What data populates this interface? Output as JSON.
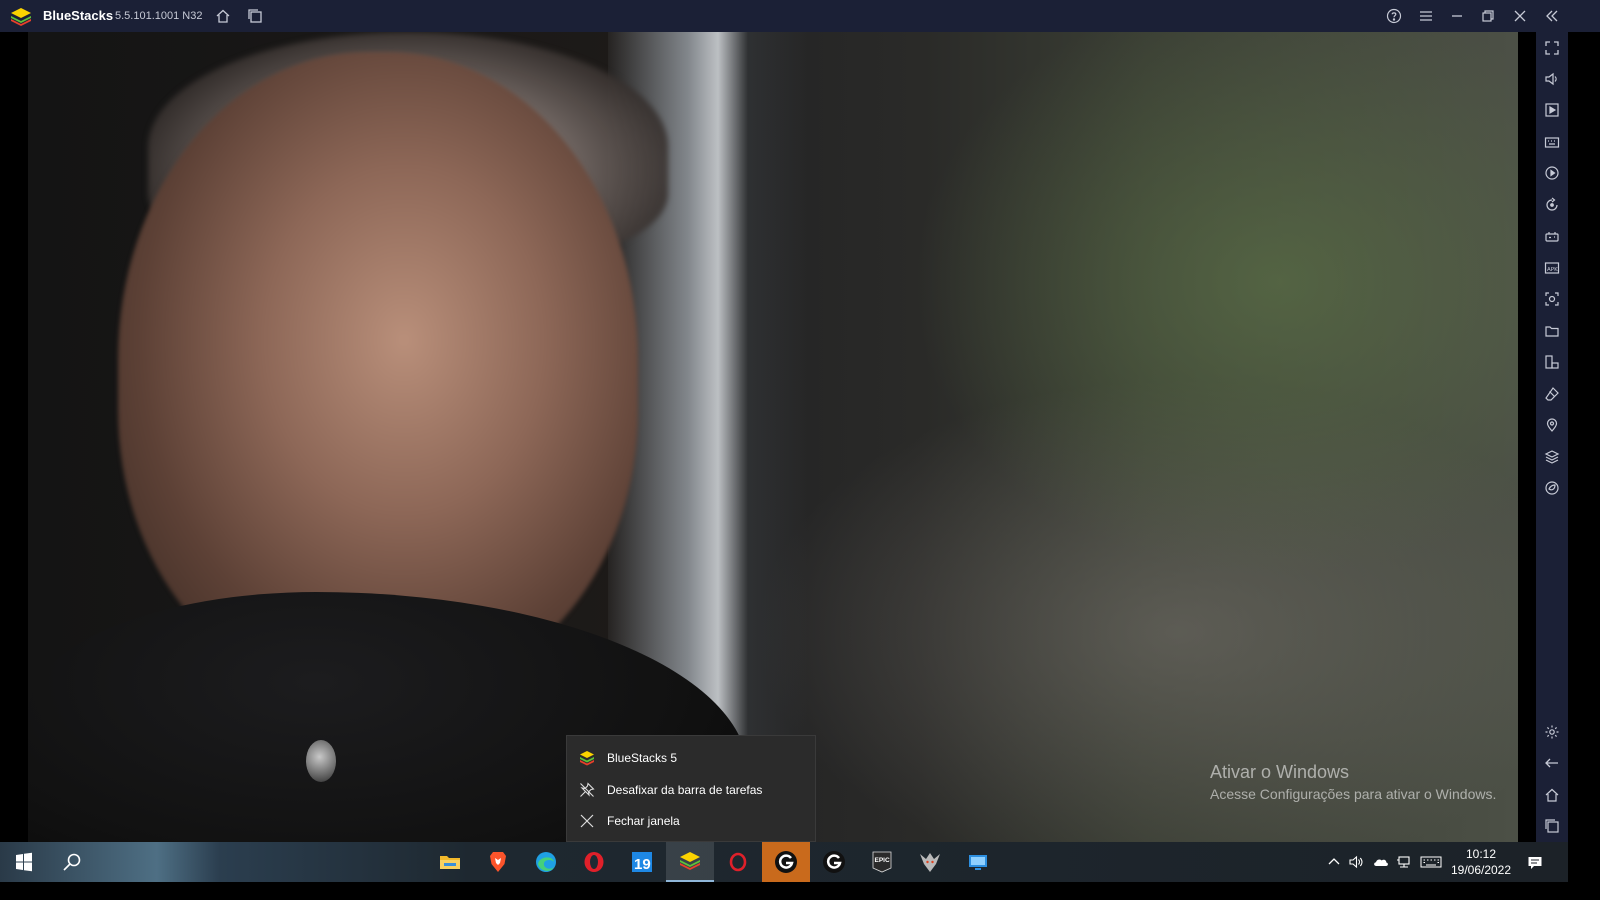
{
  "titlebar": {
    "app_name": "BlueStacks",
    "version": "5.5.101.1001 N32",
    "icons": [
      "bluestacks-logo",
      "home-icon",
      "multi-instance-icon",
      "help-icon",
      "menu-icon",
      "minimize-icon",
      "restore-icon",
      "close-icon",
      "collapse-sidebar-icon"
    ]
  },
  "sidebar": {
    "top_icons": [
      "fullscreen-icon",
      "volume-icon",
      "media-icon",
      "keyboard-icon",
      "macro-icon",
      "rotate-icon",
      "gamepad-icon",
      "apk-icon",
      "screenshot-icon",
      "folder-icon",
      "resize-icon",
      "eraser-icon",
      "location-icon",
      "layers-icon",
      "eco-mode-icon"
    ],
    "bottom_icons": [
      "settings-icon",
      "back-icon",
      "home-icon",
      "recent-apps-icon"
    ]
  },
  "watermark": {
    "title": "Ativar o Windows",
    "subtitle": "Acesse Configurações para ativar o Windows."
  },
  "context_menu": {
    "items": [
      {
        "label": "BlueStacks 5",
        "icon": "bluestacks-icon"
      },
      {
        "label": "Desafixar da barra de tarefas",
        "icon": "unpin-icon"
      },
      {
        "label": "Fechar janela",
        "icon": "close-icon"
      }
    ]
  },
  "taskbar": {
    "apps": [
      "start-icon",
      "search-icon",
      "file-explorer-icon",
      "brave-icon",
      "edge-icon",
      "opera-icon",
      "calendar-19-icon",
      "bluestacks-icon",
      "opera-gx-icon",
      "logitech-g-icon",
      "logitech-g-hub-icon",
      "epic-games-icon",
      "witcher-icon",
      "remote-desktop-icon"
    ],
    "calendar_badge": "19",
    "epic_label": "EPIC",
    "tray_icons": [
      "chevron-up-icon",
      "speaker-icon",
      "onedrive-icon",
      "network-icon",
      "keyboard-icon",
      "notification-icon"
    ]
  },
  "clock": {
    "time": "10:12",
    "date": "19/06/2022"
  },
  "colors": {
    "titlebar": "#1b2036",
    "menu_bg": "#2b2b2b",
    "highlight_task": "#c96a1c"
  }
}
